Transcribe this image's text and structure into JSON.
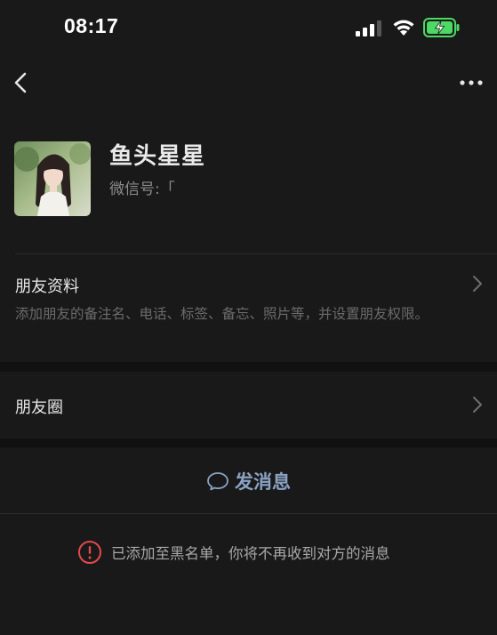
{
  "status_bar": {
    "time": "08:17",
    "icons": [
      "signal-icon",
      "wifi-icon",
      "battery-charging-icon"
    ]
  },
  "nav": {
    "back_icon": "chevron-left-icon",
    "more_icon": "more-dots-icon"
  },
  "profile": {
    "name": "鱼头星星",
    "wechat_id": "微信号:「",
    "avatar_icon": "avatar-photo"
  },
  "friend_info": {
    "title": "朋友资料",
    "description": "添加朋友的备注名、电话、标签、备忘、照片等，并设置朋友权限。"
  },
  "moments": {
    "title": "朋友圈"
  },
  "send_message": {
    "label": "发消息",
    "icon": "chat-bubble-icon"
  },
  "blocked_notice": {
    "text": "已添加至黑名单，你将不再收到对方的消息",
    "icon": "alert-circle-icon"
  },
  "colors": {
    "background": "#191919",
    "section_gap": "#111111",
    "link_blue": "#8aa2c3",
    "alert_red": "#e5484d",
    "battery_green": "#4cd964"
  }
}
